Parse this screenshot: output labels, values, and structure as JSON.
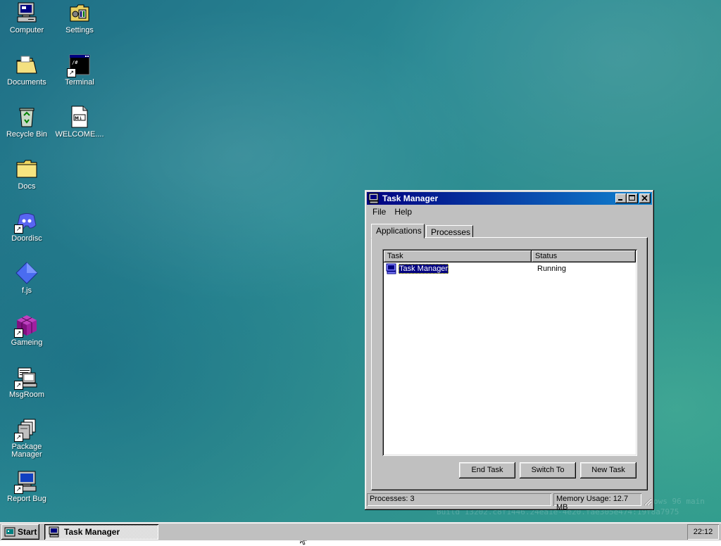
{
  "desktop": {
    "icons": [
      {
        "label": "Computer"
      },
      {
        "label": "Settings"
      },
      {
        "label": "Documents"
      },
      {
        "label": "Terminal"
      },
      {
        "label": "Recycle Bin"
      },
      {
        "label": "WELCOME...."
      },
      {
        "label": "Docs"
      },
      {
        "label": "Doordisc"
      },
      {
        "label": "f.js"
      },
      {
        "label": "Gameing"
      },
      {
        "label": "MsgRoom"
      },
      {
        "label": "Package Manager"
      },
      {
        "label": "Report Bug"
      }
    ],
    "watermark": {
      "line1": "ows 96 main",
      "line2": "Build 13202.c8f1446.24ea1e-4e20.fae305e474:19f8a7975"
    }
  },
  "window": {
    "title": "Task Manager",
    "icon": "monitor-icon",
    "menu": [
      "File",
      "Help"
    ],
    "tabs": [
      {
        "label": "Applications",
        "active": true
      },
      {
        "label": "Processes",
        "active": false
      }
    ],
    "list": {
      "columns": [
        "Task",
        "Status"
      ],
      "rows": [
        {
          "task": "Task Manager",
          "status": "Running",
          "selected": true
        }
      ]
    },
    "buttons": {
      "end_task": "End Task",
      "switch_to": "Switch To",
      "new_task": "New Task"
    },
    "status": {
      "processes": "Processes: 3",
      "memory": "Memory Usage: 12.7 MB"
    }
  },
  "taskbar": {
    "start_label": "Start",
    "tasks": [
      {
        "label": "Task Manager",
        "icon": "monitor-icon"
      }
    ],
    "clock": "22:12"
  },
  "colors": {
    "title_active_start": "#000080",
    "title_active_end": "#1084d0",
    "chrome": "#c0c0c0",
    "selection": "#000080"
  }
}
